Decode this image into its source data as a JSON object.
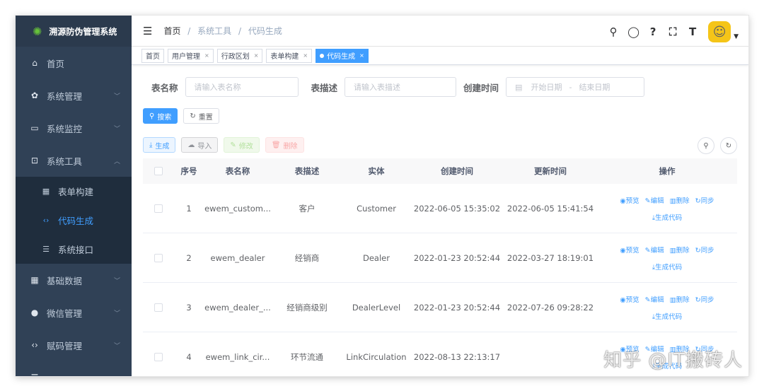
{
  "sidebar": {
    "logo_text": "溯源防伪管理系统",
    "items": [
      {
        "label": "首页",
        "icon": "dashboard-icon",
        "glyph": "⌂"
      },
      {
        "label": "系统管理",
        "icon": "gear-icon",
        "glyph": "✿"
      },
      {
        "label": "系统监控",
        "icon": "monitor-icon",
        "glyph": "▭"
      },
      {
        "label": "系统工具",
        "icon": "tool-icon",
        "glyph": "⊡"
      }
    ],
    "subitems": [
      {
        "label": "表单构建",
        "icon": "form-icon",
        "glyph": "▦"
      },
      {
        "label": "代码生成",
        "icon": "code-icon",
        "glyph": "‹›"
      },
      {
        "label": "系统接口",
        "icon": "api-icon",
        "glyph": "☰"
      }
    ],
    "items_after": [
      {
        "label": "基础数据",
        "icon": "grid-icon",
        "glyph": "▦"
      },
      {
        "label": "微信管理",
        "icon": "wechat-icon",
        "glyph": "●"
      },
      {
        "label": "赋码管理",
        "icon": "code-manage-icon",
        "glyph": "‹›"
      },
      {
        "label": "",
        "icon": "list-icon",
        "glyph": "☰"
      }
    ]
  },
  "navbar": {
    "breadcrumb": [
      "首页",
      "系统工具",
      "代码生成"
    ]
  },
  "tags": [
    "首页",
    "用户管理",
    "行政区划",
    "表单构建",
    "代码生成"
  ],
  "search": {
    "table_name_label": "表名称",
    "table_name_placeholder": "请输入表名称",
    "table_desc_label": "表描述",
    "table_desc_placeholder": "请输入表描述",
    "create_time_label": "创建时间",
    "start_placeholder": "开始日期",
    "range_sep": "-",
    "end_placeholder": "结束日期",
    "search_btn": "搜索",
    "reset_btn": "重置"
  },
  "toolbar": {
    "generate": "生成",
    "import": "导入",
    "edit": "修改",
    "delete": "删除"
  },
  "table": {
    "headers": [
      "序号",
      "表名称",
      "表描述",
      "实体",
      "创建时间",
      "更新时间",
      "操作"
    ],
    "rows": [
      {
        "idx": "1",
        "name": "ewem_custom...",
        "desc": "客户",
        "entity": "Customer",
        "created": "2022-06-05 15:35:02",
        "updated": "2022-06-05 15:41:54"
      },
      {
        "idx": "2",
        "name": "ewem_dealer",
        "desc": "经销商",
        "entity": "Dealer",
        "created": "2022-01-23 20:52:44",
        "updated": "2022-03-27 18:19:01"
      },
      {
        "idx": "3",
        "name": "ewem_dealer_...",
        "desc": "经销商级别",
        "entity": "DealerLevel",
        "created": "2022-01-23 20:52:44",
        "updated": "2022-07-26 09:28:22"
      },
      {
        "idx": "4",
        "name": "ewem_link_cir...",
        "desc": "环节流通",
        "entity": "LinkCirculation",
        "created": "2022-08-13 22:13:17",
        "updated": ""
      }
    ],
    "ops": {
      "preview": "预览",
      "edit": "编辑",
      "delete": "删除",
      "sync": "同步",
      "gen": "生成代码"
    }
  },
  "watermark": "知乎 @IT搬砖人",
  "colors": {
    "sidebar_bg": "#304156",
    "primary": "#409eff",
    "active_tag": "#409eff"
  }
}
